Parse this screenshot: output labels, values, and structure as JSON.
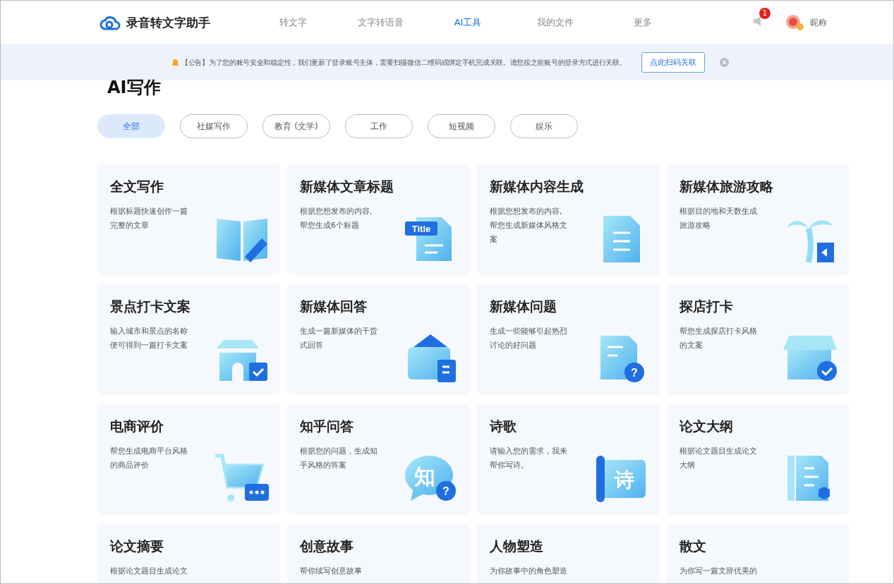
{
  "header": {
    "logo": "录音转文字助手",
    "nav": [
      {
        "label": "转文字",
        "selected": false
      },
      {
        "label": "文字转语音",
        "selected": false
      },
      {
        "label": "AI工具",
        "selected": true
      },
      {
        "label": "我的文件",
        "selected": false
      },
      {
        "label": "更多",
        "selected": false
      }
    ],
    "notification_count": "1",
    "user": "昵称"
  },
  "notice": {
    "text": "【公告】为了您的账号安全和稳定性，我们更新了登录账号主体，需要扫描微信二维码或绑定手机完成关联。请您按之前账号的登录方式进行关联。",
    "button": "点此扫码关联"
  },
  "section_title": "AI写作",
  "filters": [
    {
      "label": "全部",
      "selected": true
    },
    {
      "label": "社媒写作",
      "selected": false
    },
    {
      "label": "教育 (文学)",
      "selected": false
    },
    {
      "label": "工作",
      "selected": false
    },
    {
      "label": "短视频",
      "selected": false
    },
    {
      "label": "娱乐",
      "selected": false
    }
  ],
  "cards": [
    {
      "title": "全文写作",
      "description": [
        "根据标题快速创作一篇",
        "完整的文章"
      ]
    },
    {
      "title": "新媒体文章标题",
      "description": [
        "根据您想发布的内容,",
        "帮您生成6个标题"
      ],
      "icon_texts": [
        "Title"
      ]
    },
    {
      "title": "新媒体内容生成",
      "description": [
        "根据您想发布的内容,",
        "帮您生成新媒体风格文",
        "案"
      ]
    },
    {
      "title": "新媒体旅游攻略",
      "description": [
        "根据目的地和天数生成",
        "旅游攻略"
      ]
    },
    {
      "title": "景点打卡文案",
      "description": [
        "输入城市和景点的名称",
        "便可得到一篇打卡文案"
      ]
    },
    {
      "title": "新媒体回答",
      "description": [
        "生成一篇新媒体的干货",
        "式回答"
      ]
    },
    {
      "title": "新媒体问题",
      "description": [
        "生成一些能够引起热烈",
        "讨论的好问题"
      ],
      "icon_texts": [
        "?"
      ]
    },
    {
      "title": "探店打卡",
      "description": [
        "帮您生成探店打卡风格",
        "的文案"
      ]
    },
    {
      "title": "电商评价",
      "description": [
        "帮您生成电商平台风格",
        "的商品评价"
      ]
    },
    {
      "title": "知乎问答",
      "description": [
        "根据您的问题，生成知",
        "乎风格的答案"
      ],
      "icon_texts": [
        "知",
        "?"
      ]
    },
    {
      "title": "诗歌",
      "description": [
        "请输入您的需求，我来",
        "帮你写诗。"
      ],
      "icon_texts": [
        "诗"
      ]
    },
    {
      "title": "论文大纲",
      "description": [
        "根据论文题目生成论文",
        "大纲"
      ]
    },
    {
      "title": "论文摘要",
      "description": [
        "根据论文题目生成论文"
      ]
    },
    {
      "title": "创意故事",
      "description": [
        "帮你续写创意故事"
      ]
    },
    {
      "title": "人物塑造",
      "description": [
        "为你故事中的角色塑造"
      ]
    },
    {
      "title": "散文",
      "description": [
        "为你写一篇文辞优美的"
      ]
    }
  ]
}
